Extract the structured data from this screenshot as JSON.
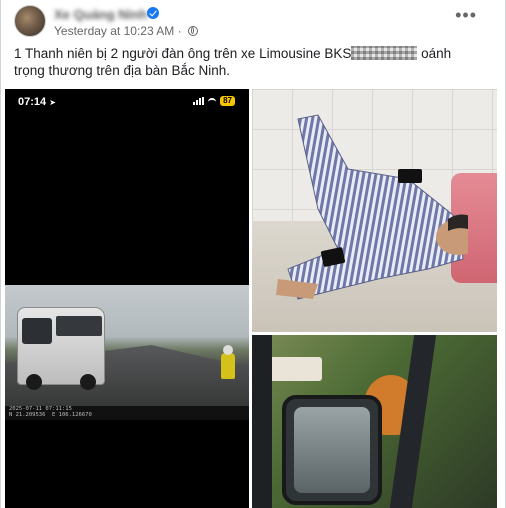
{
  "post": {
    "author": "Xe Quảng Ninh",
    "timestamp": "Yesterday at 10:23 AM ·",
    "text_before": "1 Thanh niên bị 2 người đàn ông trên xe Limousine BKS",
    "text_after": " oánh trọng thương trên địa bàn Bắc Ninh."
  },
  "media": {
    "video_phone": {
      "status_time": "07:14",
      "battery": "87",
      "dashcam_overlay": "2025-07-11 07:11:15\nN 21.209536  E 106.126670"
    }
  },
  "icons": [
    "verified-badge-icon",
    "globe-icon",
    "more-options-icon",
    "location-arrow-icon",
    "signal-icon",
    "wifi-icon"
  ],
  "colors": {
    "verified": "#1877f2",
    "meta_text": "#65676b",
    "battery": "#f7c600",
    "pillow": "#e07a86"
  }
}
